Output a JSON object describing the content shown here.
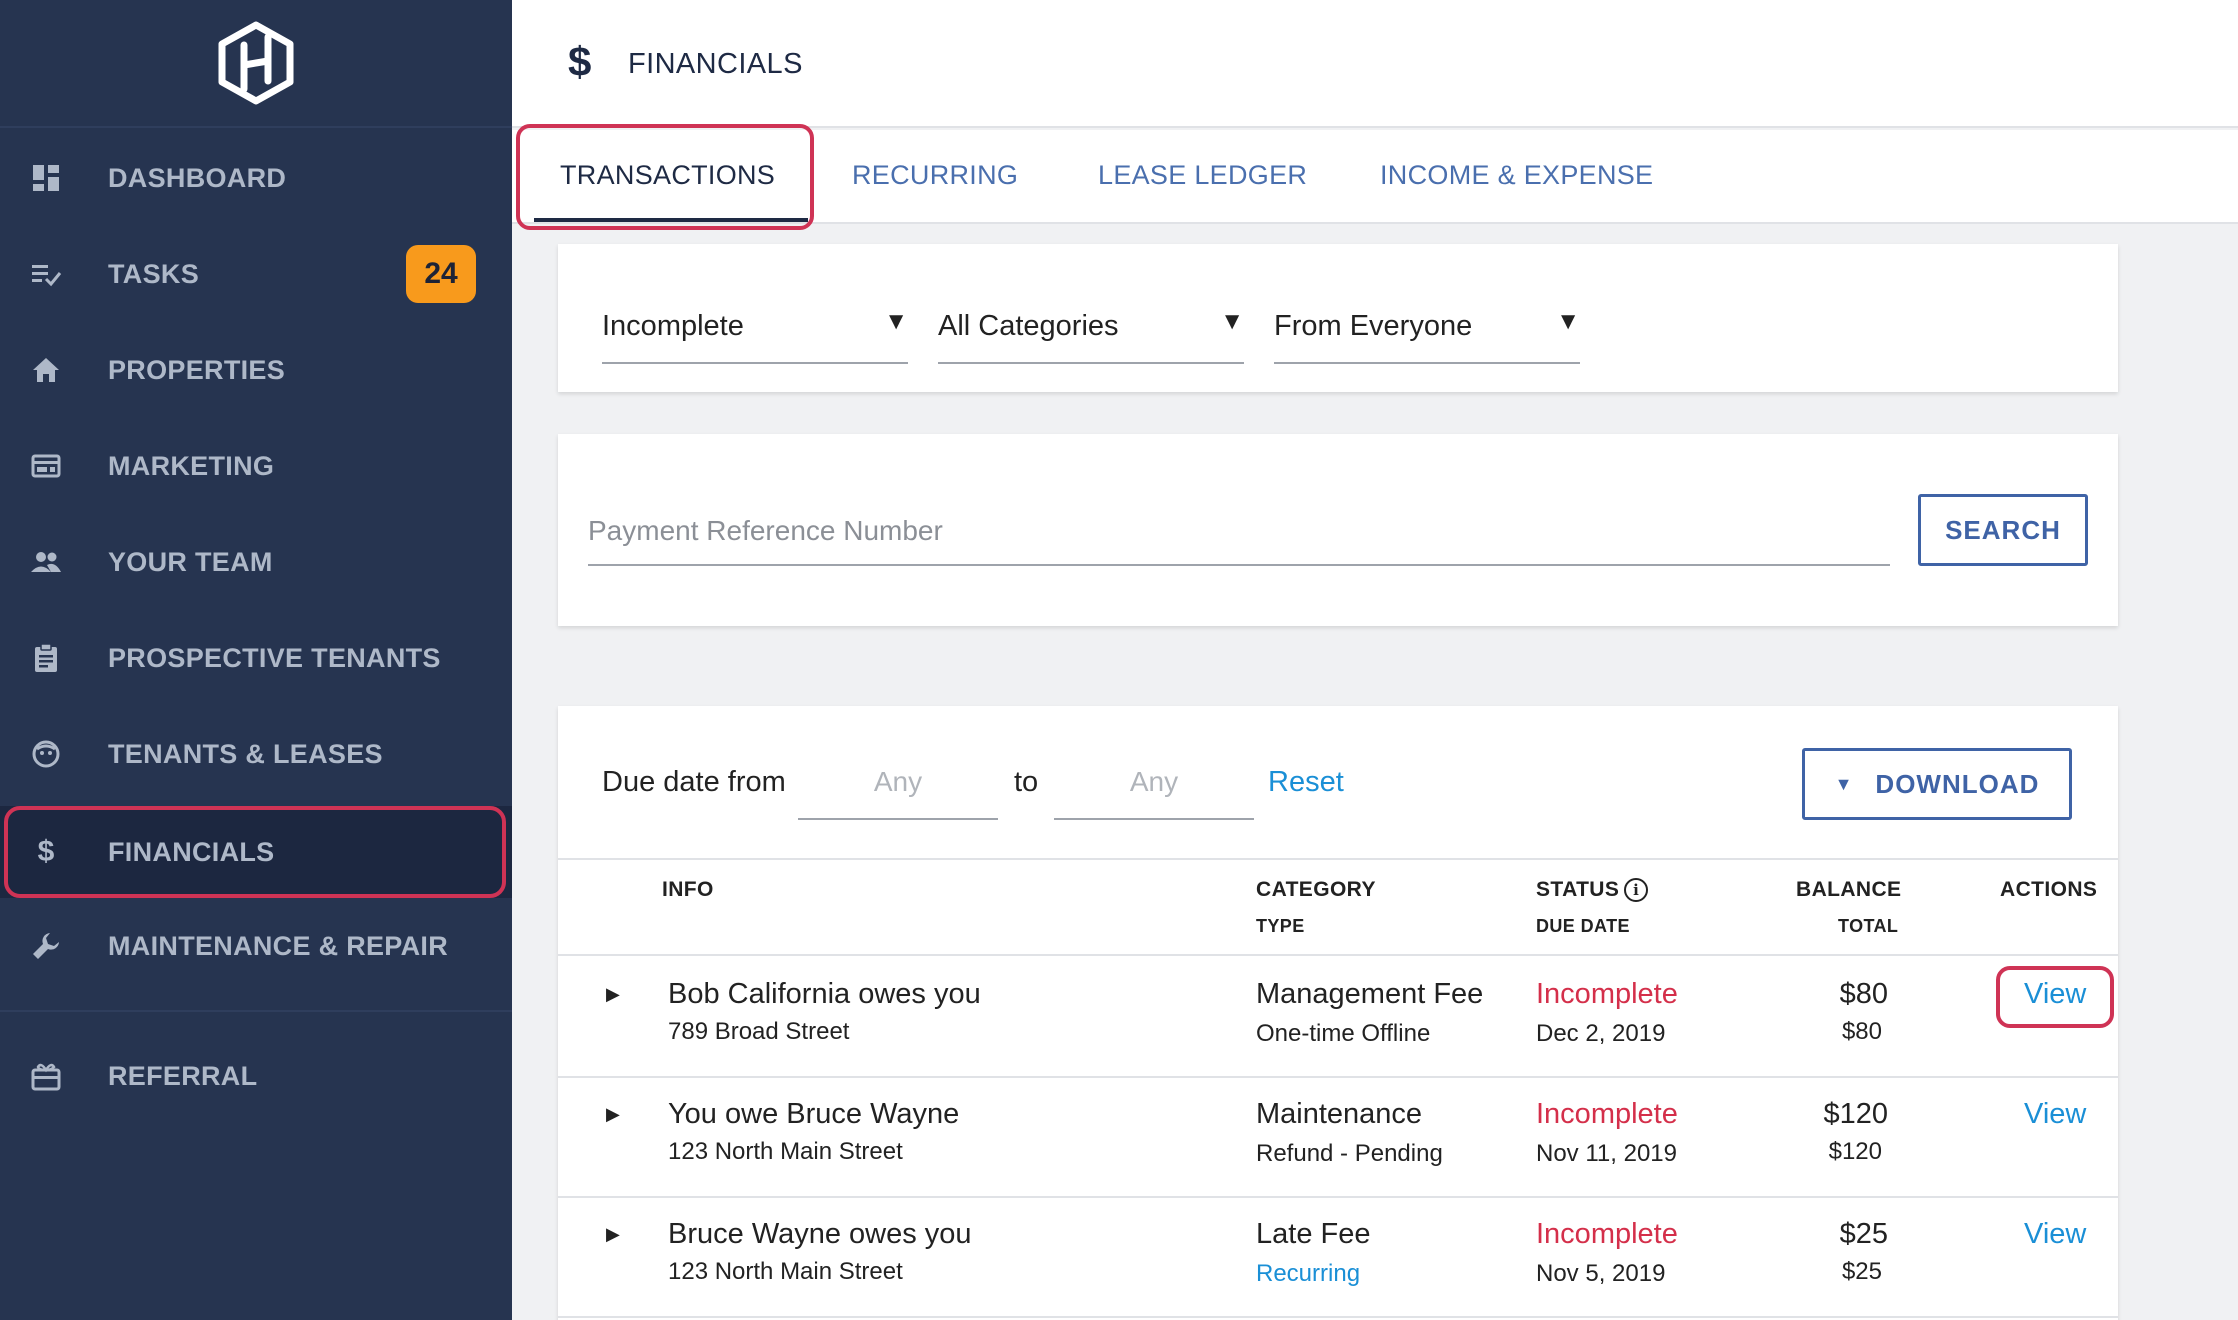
{
  "app": {
    "logo": "hexagon-h-logo"
  },
  "sidebar": {
    "items": [
      {
        "label": "DASHBOARD",
        "icon": "dashboard-icon"
      },
      {
        "label": "TASKS",
        "icon": "tasks-icon",
        "badge": "24"
      },
      {
        "label": "PROPERTIES",
        "icon": "home-icon"
      },
      {
        "label": "MARKETING",
        "icon": "marketing-icon"
      },
      {
        "label": "YOUR TEAM",
        "icon": "team-icon"
      },
      {
        "label": "PROSPECTIVE TENANTS",
        "icon": "clipboard-icon"
      },
      {
        "label": "TENANTS & LEASES",
        "icon": "tenant-face-icon"
      },
      {
        "label": "FINANCIALS",
        "icon": "dollar-icon",
        "active": true
      },
      {
        "label": "MAINTENANCE & REPAIR",
        "icon": "wrench-icon"
      },
      {
        "label": "REFERRAL",
        "icon": "gift-icon"
      }
    ]
  },
  "header": {
    "icon": "$",
    "title": "FINANCIALS"
  },
  "tabs": [
    {
      "label": "TRANSACTIONS",
      "active": true
    },
    {
      "label": "RECURRING"
    },
    {
      "label": "LEASE LEDGER"
    },
    {
      "label": "INCOME & EXPENSE"
    }
  ],
  "filters": {
    "status": "Incomplete",
    "category": "All Categories",
    "from": "From Everyone"
  },
  "search": {
    "placeholder": "Payment Reference Number",
    "button": "SEARCH"
  },
  "date_filter": {
    "label": "Due date from",
    "from_placeholder": "Any",
    "to_label": "to",
    "to_placeholder": "Any",
    "reset": "Reset",
    "download": "DOWNLOAD"
  },
  "table": {
    "headers": {
      "info": "INFO",
      "category": "CATEGORY",
      "type": "TYPE",
      "status": "STATUS",
      "due_date": "DUE DATE",
      "balance": "BALANCE",
      "total": "TOTAL",
      "actions": "ACTIONS"
    },
    "rows": [
      {
        "info": "Bob California owes you",
        "address": "789 Broad Street",
        "category": "Management Fee",
        "type": "One-time Offline",
        "status": "Incomplete",
        "due": "Dec 2, 2019",
        "balance": "$80",
        "total": "$80",
        "action": "View"
      },
      {
        "info": "You owe Bruce Wayne",
        "address": "123 North Main Street",
        "category": "Maintenance",
        "type": "Refund - Pending",
        "status": "Incomplete",
        "due": "Nov 11, 2019",
        "balance": "$120",
        "total": "$120",
        "action": "View"
      },
      {
        "info": "Bruce Wayne owes you",
        "address": "123 North Main Street",
        "category": "Late Fee",
        "type": "Recurring",
        "status": "Incomplete",
        "due": "Nov 5, 2019",
        "balance": "$25",
        "total": "$25",
        "action": "View"
      }
    ]
  },
  "colors": {
    "sidebar_bg": "#263450",
    "accent_blue": "#3f63a6",
    "link_blue": "#1a8fd6",
    "status_red": "#d42f4a",
    "badge_orange": "#f89a1c",
    "highlight": "#cf3355"
  }
}
